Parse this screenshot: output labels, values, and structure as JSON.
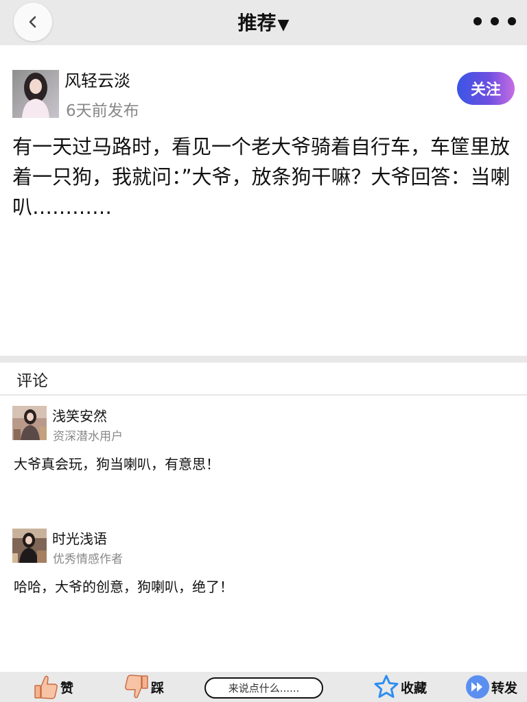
{
  "header": {
    "title": "推荐",
    "title_caret": "▼"
  },
  "post": {
    "author_name": "风轻云淡",
    "time": "6天前发布",
    "follow_label": "关注",
    "content": "有一天过马路时，看见一个老大爷骑着自行车，车筐里放着一只狗，我就问：”大爷，放条狗干嘛？大爷回答：当喇叭…………"
  },
  "comments": {
    "heading": "评论",
    "items": [
      {
        "name": "浅笑安然",
        "title": "资深潜水用户",
        "text": "大爷真会玩，狗当喇叭，有意思！"
      },
      {
        "name": "时光浅语",
        "title": "优秀情感作者",
        "text": "哈哈，大爷的创意，狗喇叭，绝了！"
      }
    ]
  },
  "bottom_bar": {
    "like_label": "赞",
    "dislike_label": "踩",
    "comment_placeholder": "来说点什么......",
    "favorite_label": "收藏",
    "share_label": "转发"
  },
  "colors": {
    "follow_gradient_start": "#3a56e6",
    "follow_gradient_end": "#c76de3",
    "star_blue": "#2d8ef0",
    "share_blue": "#5a8ff0",
    "thumb_orange": "#f0a07a"
  }
}
